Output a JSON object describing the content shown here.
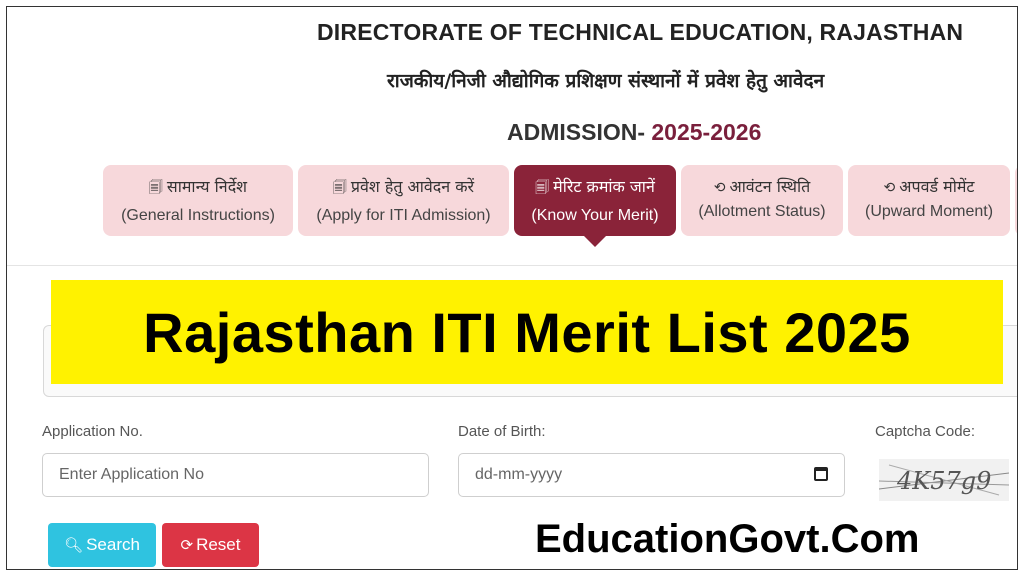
{
  "header": {
    "org_title": "DIRECTORATE OF TECHNICAL EDUCATION, RAJASTHAN",
    "subtitle_hindi": "राजकीय/निजी औद्योगिक प्रशिक्षण संस्थानों में प्रवेश हेतु आवेदन",
    "admission_label": "ADMISSION-",
    "admission_year": "2025-2026"
  },
  "tabs": [
    {
      "hindi": "सामान्य निर्देश",
      "english": "(General Instructions)",
      "icon": "document-icon",
      "active": false
    },
    {
      "hindi": "प्रवेश हेतु आवेदन करें",
      "english": "(Apply for ITI Admission)",
      "icon": "document-icon",
      "active": false
    },
    {
      "hindi": "मेरिट क्रमांक जानें",
      "english": "(Know Your Merit)",
      "icon": "document-icon",
      "active": true
    },
    {
      "hindi": "आवंटन स्थिति",
      "english": "(Allotment Status)",
      "icon": "sync-icon",
      "active": false
    },
    {
      "hindi": "अपवर्ड मोमेंट",
      "english": "(Upward Moment)",
      "icon": "sync-icon",
      "active": false
    }
  ],
  "banner": {
    "text": "Rajasthan ITI Merit List 2025"
  },
  "form": {
    "application_label": "Application No.",
    "application_placeholder": "Enter Application No",
    "dob_label": "Date of Birth:",
    "dob_placeholder": "dd-mm-yyyy",
    "captcha_label": "Captcha Code:",
    "captcha_text": "4K57g9"
  },
  "buttons": {
    "search": "Search",
    "reset": "Reset"
  },
  "watermark": "EducationGovt.Com",
  "colors": {
    "active_tab": "#8a2339",
    "inactive_tab": "#f7d8db",
    "year": "#7a1f3c",
    "banner": "#fff200",
    "search_button": "#2fc3e0",
    "reset_button": "#dc3545"
  }
}
